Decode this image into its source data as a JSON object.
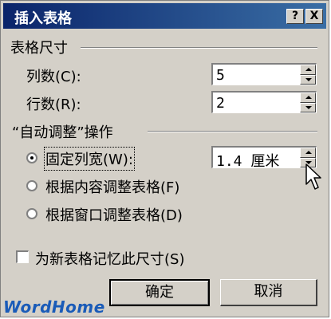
{
  "dialog": {
    "title": "插入表格",
    "help_button": "?",
    "close_button": "X"
  },
  "size_group": {
    "title": "表格尺寸",
    "columns_label": "列数(C):",
    "columns_value": "5",
    "rows_label": "行数(R):",
    "rows_value": "2"
  },
  "autofit_group": {
    "title": "“自动调整”操作",
    "options": [
      {
        "label": "固定列宽(W):",
        "selected": true
      },
      {
        "label": "根据内容调整表格(F)",
        "selected": false
      },
      {
        "label": "根据窗口调整表格(D)",
        "selected": false
      }
    ],
    "width_value": "1.4 厘米"
  },
  "remember_checkbox": {
    "label": "为新表格记忆此尺寸(S)",
    "checked": false
  },
  "buttons": {
    "ok": "确定",
    "cancel": "取消"
  },
  "watermark": "WordHome",
  "icons": [
    "help-icon",
    "close-icon",
    "spin-up-icon",
    "spin-down-icon",
    "mouse-cursor-icon"
  ],
  "colors": {
    "titlebar_start": "#0a246a",
    "titlebar_end": "#3a6ea5",
    "dialog_bg": "#d4d0c8",
    "watermark": "#1a5bb8"
  }
}
